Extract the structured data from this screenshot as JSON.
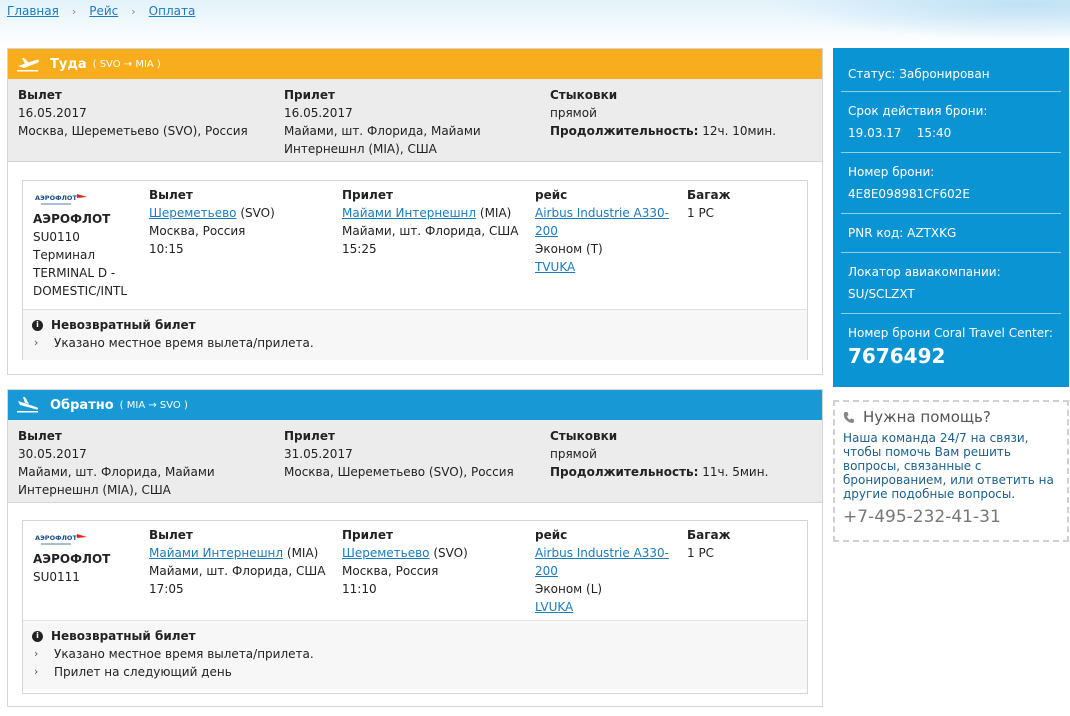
{
  "breadcrumb": [
    "Главная",
    "Рейс",
    "Оплата"
  ],
  "colors": {
    "outbound": "#f8ae1c",
    "return": "#1899d6",
    "sidebar": "#0a94d4",
    "link": "#1a7bbf"
  },
  "outbound": {
    "title": "Туда",
    "route": "( SVO → MIA )",
    "summary": {
      "departure_label": "Вылет",
      "departure_date": "16.05.2017",
      "departure_place": "Москва, Шереметьево (SVO), Россия",
      "arrival_label": "Прилет",
      "arrival_date": "16.05.2017",
      "arrival_place_1": "Майами, шт. Флорида, Майами",
      "arrival_place_2": "Интернешнл (MIA), США",
      "stops_label": "Стыковки",
      "stops_value": "прямой",
      "duration_label": "Продолжительность:",
      "duration_value": "12ч. 10мин."
    },
    "segment": {
      "logo_text": "АЭРОФЛОТ",
      "airline": "АЭРОФЛОТ",
      "flight": "SU0110",
      "terminal_1": "Терминал",
      "terminal_2": "TERMINAL D -",
      "terminal_3": "DOMESTIC/INTL",
      "dep_label": "Вылет",
      "dep_airport": "Шереметьево",
      "dep_code": "(SVO)",
      "dep_city": "Москва, Россия",
      "dep_time": "10:15",
      "arr_label": "Прилет",
      "arr_airport": "Майами Интернешнл",
      "arr_code": "(MIA)",
      "arr_city": "Майами, шт. Флорида, США",
      "arr_time": "15:25",
      "flight_label": "рейс",
      "aircraft_1": "Airbus Industrie A330-",
      "aircraft_2": "200",
      "cabin": "Эконом (T)",
      "fare": "TVUKA",
      "baggage_label": "Багаж",
      "baggage": "1 PC",
      "note_main": "Невозвратный билет",
      "notes": [
        "Указано местное время вылета/прилета."
      ]
    }
  },
  "return": {
    "title": "Обратно",
    "route": "( MIA → SVO )",
    "summary": {
      "departure_label": "Вылет",
      "departure_date": "30.05.2017",
      "departure_place_1": "Майами, шт. Флорида, Майами",
      "departure_place_2": "Интернешнл (MIA), США",
      "arrival_label": "Прилет",
      "arrival_date": "31.05.2017",
      "arrival_place": "Москва, Шереметьево (SVO), Россия",
      "stops_label": "Стыковки",
      "stops_value": "прямой",
      "duration_label": "Продолжительность:",
      "duration_value": "11ч. 5мин."
    },
    "segment": {
      "logo_text": "АЭРОФЛОТ",
      "airline": "АЭРОФЛОТ",
      "flight": "SU0111",
      "dep_label": "Вылет",
      "dep_airport": "Майами Интернешнл",
      "dep_code": "(MIA)",
      "dep_city": "Майами, шт. Флорида, США",
      "dep_time": "17:05",
      "arr_label": "Прилет",
      "arr_airport": "Шереметьево",
      "arr_code": "(SVO)",
      "arr_city": "Москва, Россия",
      "arr_time": "11:10",
      "flight_label": "рейс",
      "aircraft_1": "Airbus Industrie A330-",
      "aircraft_2": "200",
      "cabin": "Эконом (L)",
      "fare": "LVUKA",
      "baggage_label": "Багаж",
      "baggage": "1 PC",
      "note_main": "Невозвратный билет",
      "notes": [
        "Указано местное время вылета/прилета.",
        "Прилет на следующий день"
      ]
    }
  },
  "sidebar": {
    "status": "Статус: Забронирован",
    "validity_label": "Срок действия брони:",
    "validity_date": "19.03.17",
    "validity_time": "15:40",
    "booking_label": "Номер брони:",
    "booking_value": "4E8E098981CF602E",
    "pnr": "PNR код: AZTXKG",
    "locator_label": "Локатор авиакомпании:",
    "locator_value": "SU/SCLZXT",
    "coral_label": "Номер брони Coral Travel Center:",
    "coral_value": "7676492"
  },
  "help": {
    "title": "Нужна помощь?",
    "text": "Наша команда 24/7 на связи, чтобы помочь Вам решить вопросы, связанные с бронированием, или ответить на другие подобные вопросы.",
    "phone": "+7-495-232-41-31"
  }
}
